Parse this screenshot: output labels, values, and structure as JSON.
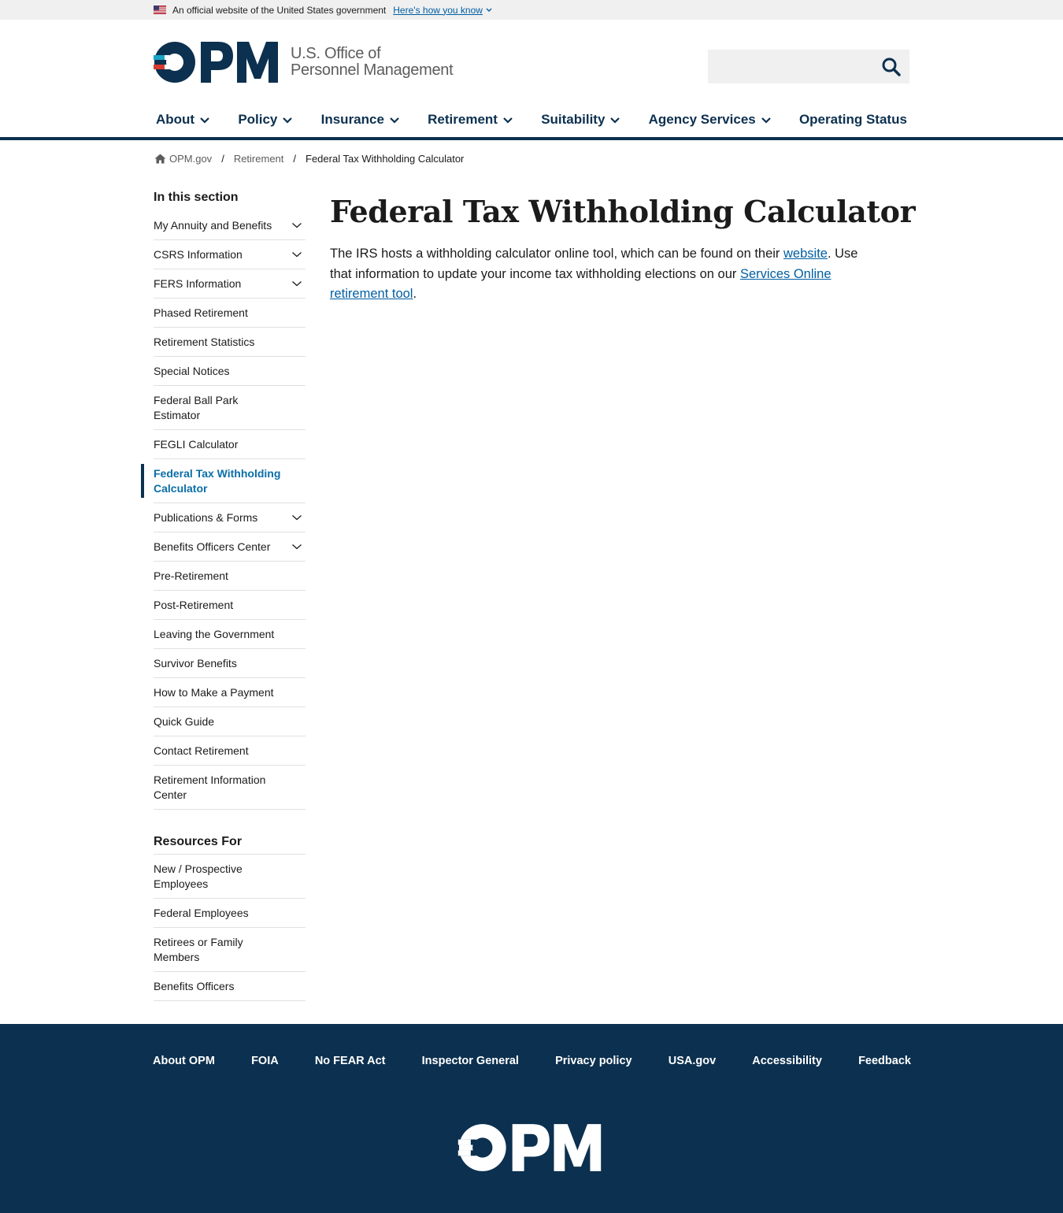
{
  "gov_banner": {
    "text": "An official website of the United States government",
    "link": "Here's how you know"
  },
  "header": {
    "logo_text_line1": "U.S. Office of",
    "logo_text_line2": "Personnel Management",
    "search_placeholder": ""
  },
  "nav": {
    "items": [
      {
        "label": "About",
        "dropdown": true
      },
      {
        "label": "Policy",
        "dropdown": true
      },
      {
        "label": "Insurance",
        "dropdown": true
      },
      {
        "label": "Retirement",
        "dropdown": true,
        "active": true
      },
      {
        "label": "Suitability",
        "dropdown": true
      },
      {
        "label": "Agency Services",
        "dropdown": true
      },
      {
        "label": "Operating Status",
        "dropdown": false
      }
    ]
  },
  "breadcrumb": {
    "home": "OPM.gov",
    "parent": "Retirement",
    "current": "Federal Tax Withholding Calculator",
    "separator": "/"
  },
  "sidebar": {
    "title": "In this section",
    "items": [
      {
        "label": "My Annuity and Benefits",
        "expandable": true
      },
      {
        "label": "CSRS Information",
        "expandable": true
      },
      {
        "label": "FERS Information",
        "expandable": true
      },
      {
        "label": "Phased Retirement"
      },
      {
        "label": "Retirement Statistics"
      },
      {
        "label": "Special Notices"
      },
      {
        "label": "Federal Ball Park Estimator"
      },
      {
        "label": "FEGLI Calculator"
      },
      {
        "label": "Federal Tax Withholding Calculator",
        "current": true
      },
      {
        "label": "Publications & Forms",
        "expandable": true
      },
      {
        "label": "Benefits Officers Center",
        "expandable": true
      },
      {
        "label": "Pre-Retirement"
      },
      {
        "label": "Post-Retirement"
      },
      {
        "label": "Leaving the Government"
      },
      {
        "label": "Survivor Benefits"
      },
      {
        "label": "How to Make a Payment"
      },
      {
        "label": "Quick Guide"
      },
      {
        "label": "Contact Retirement"
      },
      {
        "label": "Retirement Information Center"
      }
    ],
    "resources_title": "Resources For",
    "resources": [
      {
        "label": "New / Prospective Employees"
      },
      {
        "label": "Federal Employees"
      },
      {
        "label": "Retirees or Family Members"
      },
      {
        "label": "Benefits Officers"
      }
    ]
  },
  "main": {
    "title": "Federal Tax Withholding Calculator",
    "para_part1": "The IRS hosts a withholding calculator online tool, which can be found on their ",
    "link1": "website",
    "para_part2": ". Use that information to update your income tax withholding elections on our ",
    "link2": "Services Online retirement tool",
    "para_part3": "."
  },
  "footer": {
    "links": [
      "About OPM",
      "FOIA",
      "No FEAR Act",
      "Inspector General",
      "Privacy policy",
      "USA.gov",
      "Accessibility",
      "Feedback"
    ],
    "logo_alt": "OPM"
  },
  "colors": {
    "navy": "#0c304f",
    "accent_teal": "#1aa5c6",
    "link_blue": "#005ea2",
    "logo_red": "#d83933",
    "logo_blue": "#1aa5c6"
  }
}
